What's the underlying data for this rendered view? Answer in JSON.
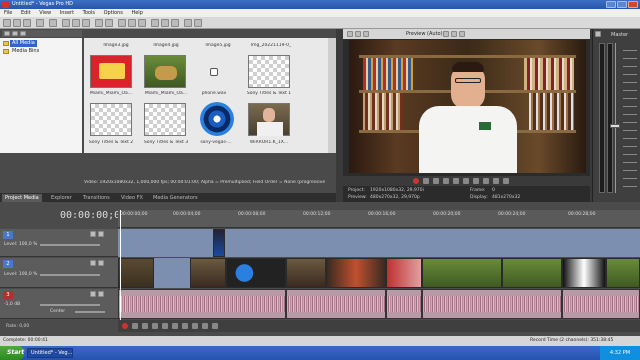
{
  "window": {
    "title": "Untitled* - Vegas Pro HD"
  },
  "menu": [
    "File",
    "Edit",
    "View",
    "Insert",
    "Tools",
    "Options",
    "Help"
  ],
  "media": {
    "tree": [
      {
        "label": "All Media",
        "selected": true
      },
      {
        "label": "Media Bins",
        "selected": false
      }
    ],
    "thumbs": [
      {
        "label": "Image3.jpg",
        "top": "",
        "kind": "label-only"
      },
      {
        "label": "Image4.jpg",
        "top": "",
        "kind": "label-only"
      },
      {
        "label": "Image5.jpg",
        "top": "",
        "kind": "label-only"
      },
      {
        "label": "Img_20221119-0_",
        "kind": "label-only"
      },
      {
        "label": "Miami_Miami_Oa...",
        "kind": "red"
      },
      {
        "label": "Miami_Miami_Oa...",
        "kind": "green"
      },
      {
        "label": "phone.wav",
        "kind": "audio"
      },
      {
        "label": "Sony Titles & Text 1",
        "kind": "checker"
      },
      {
        "label": "Sony Titles & Text 2",
        "kind": "checker"
      },
      {
        "label": "Sony Titles & Text 3",
        "kind": "checker"
      },
      {
        "label": "sony-vegas-...",
        "kind": "lens"
      },
      {
        "label": "WiRROR1.K_1X...",
        "kind": "person"
      }
    ],
    "info": "Video: 1920x1080x32, 1,000,000 fps; 00:00:01:00; Alpha = Premultiplied; Field Order = None (progressive",
    "tabs": [
      "Project Media",
      "Explorer",
      "Transitions",
      "Video FX",
      "Media Generators"
    ]
  },
  "preview": {
    "mode": "Preview (Auto)",
    "project_label": "Project:",
    "project_value": "1920x1080x32, 29,970i",
    "preview_label": "Preview:",
    "preview_value": "480x270x32, 29,970p",
    "frame_label": "Frame:",
    "frame_value": "0",
    "display_label": "Display:",
    "display_value": "481x270x32"
  },
  "master": {
    "label": "Master"
  },
  "timeline": {
    "timecode": "00:00:00;00",
    "ruler": [
      "00:00:00;00",
      "00:00:04;00",
      "00:00:08;00",
      "00:00:12;00",
      "00:00:16;00",
      "00:00:20;00",
      "00:00:24;00",
      "00:00:28;00"
    ],
    "tracks": [
      {
        "num": "1",
        "label": "Level: 100,0 %"
      },
      {
        "num": "2",
        "label": "Level: 100,0 %"
      },
      {
        "num": "3",
        "vol": "-1,0 dB",
        "pan": "Center"
      }
    ]
  },
  "transport": {
    "rate": "Rate: 0,00"
  },
  "status": {
    "left": "Complete: 00:00:41",
    "record": "Record Time (2 channels): 351:38:45"
  },
  "taskbar": {
    "start": "Start",
    "item": "Untitled* - Veg...",
    "clock": "4:32 PM"
  },
  "colors": {
    "accent": "#3064c8",
    "track_header": "#5c5c5c",
    "video_lane": "#7d8fb0",
    "audio_clip": "#b89aa6"
  }
}
